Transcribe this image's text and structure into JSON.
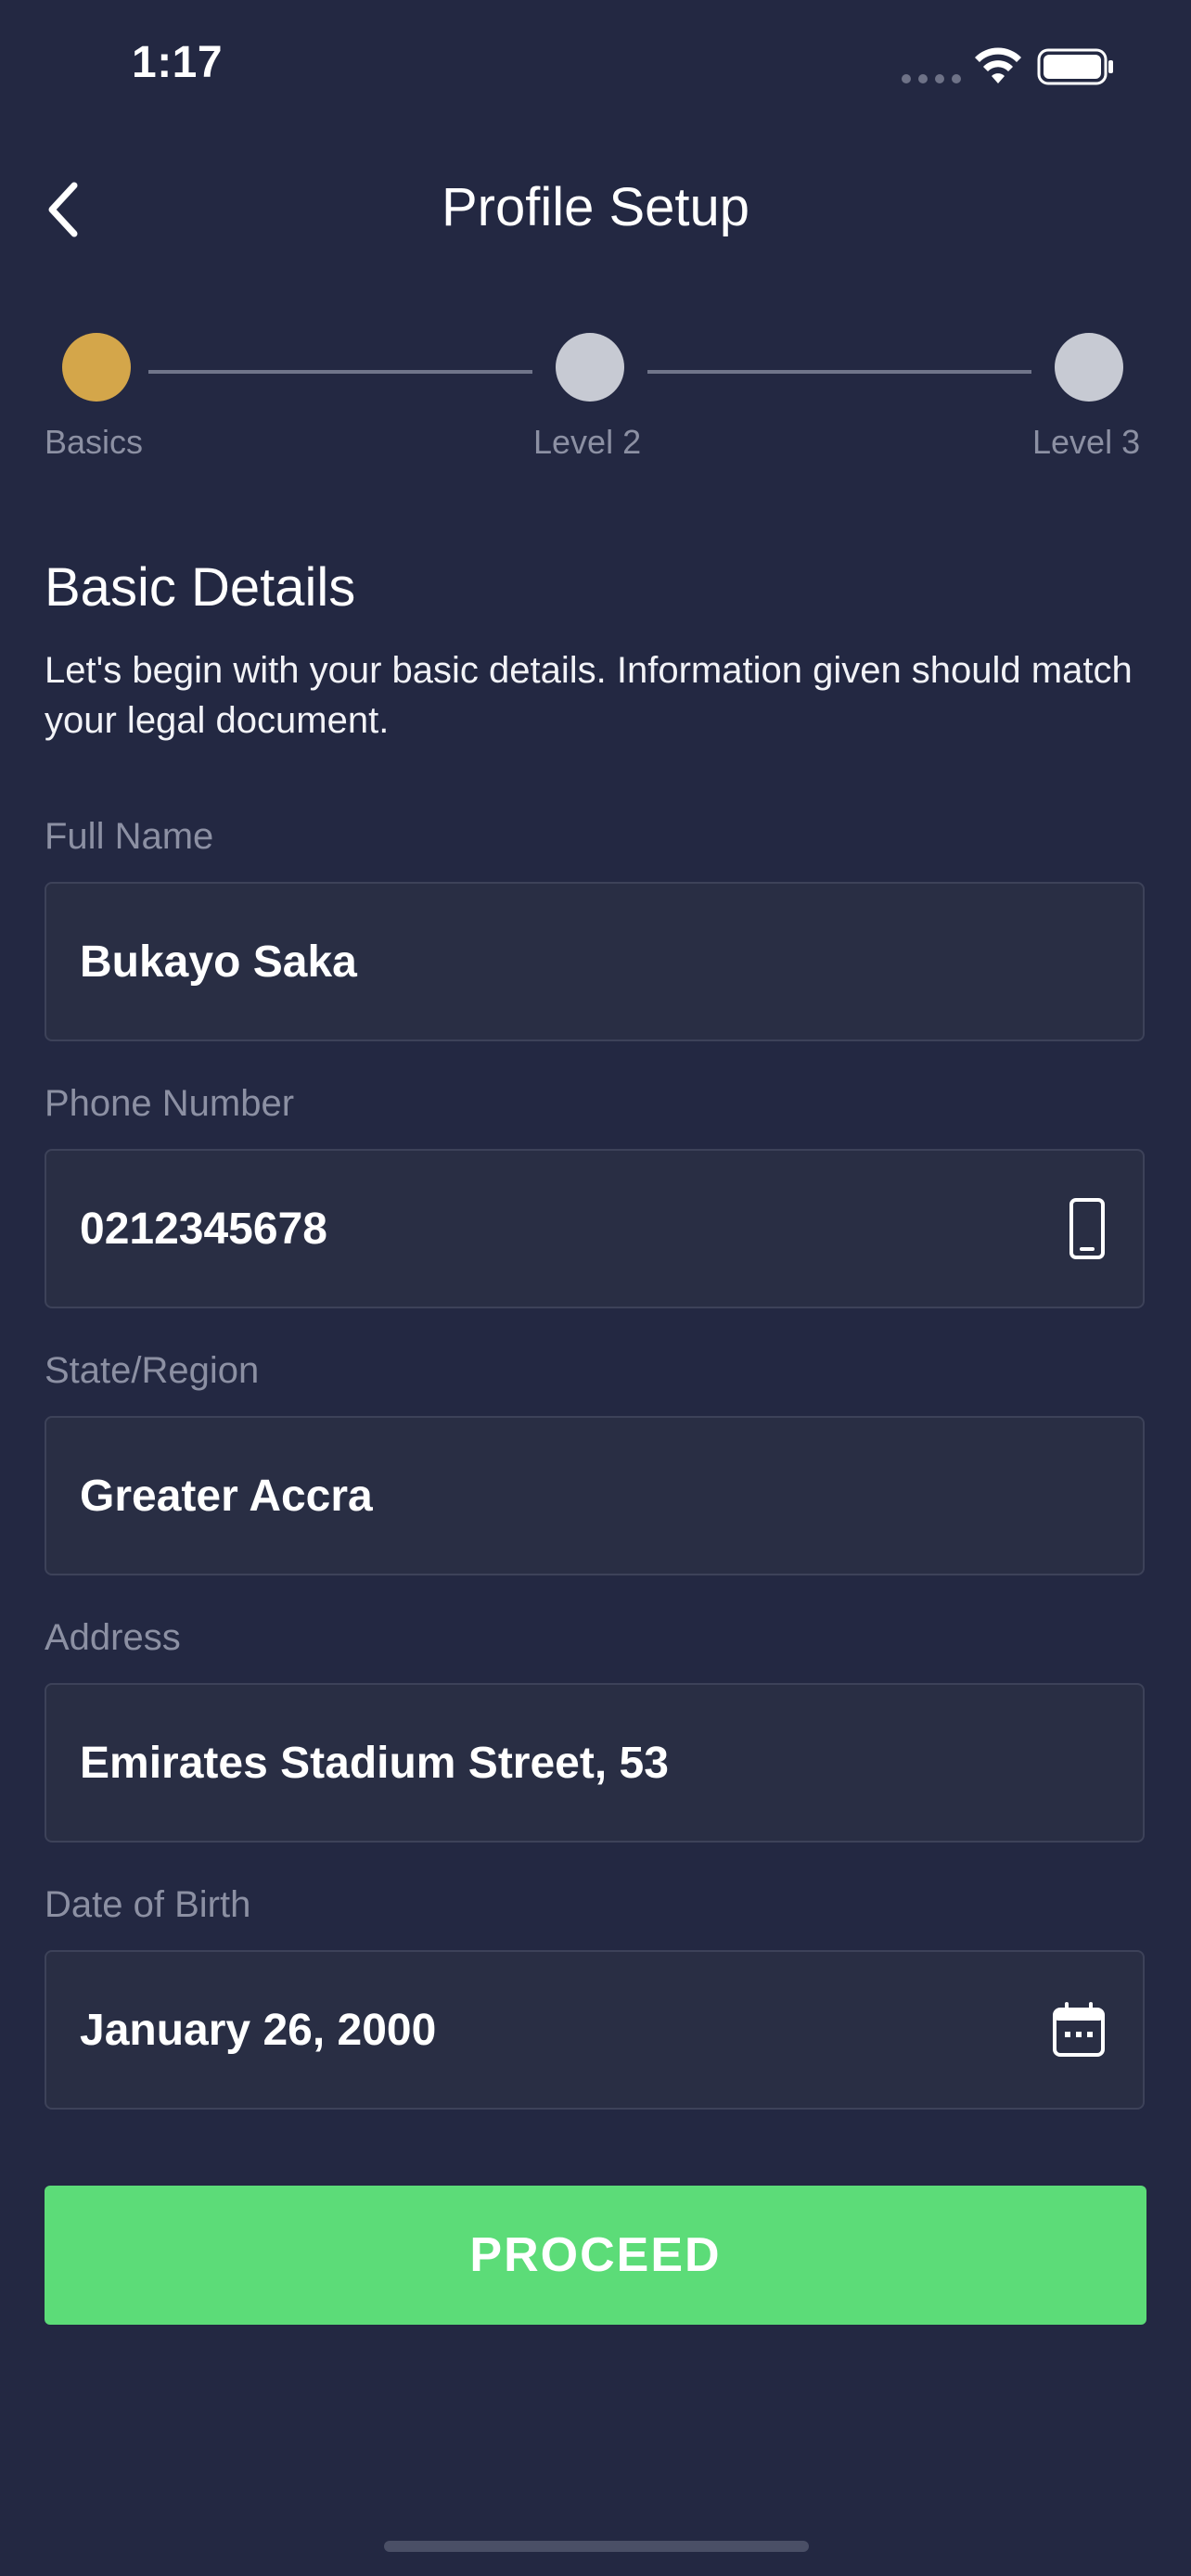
{
  "status_bar": {
    "time": "1:17"
  },
  "nav": {
    "back_icon": "chevron-left-icon",
    "title": "Profile Setup"
  },
  "stepper": {
    "steps": [
      {
        "label": "Basics",
        "state": "active",
        "color": "#d4a64a"
      },
      {
        "label": "Level 2",
        "state": "pending",
        "color": "#c7cad3"
      },
      {
        "label": "Level 3",
        "state": "pending",
        "color": "#c7cad3"
      }
    ]
  },
  "section": {
    "title": "Basic Details",
    "description": "Let's begin with your basic details. Information given should match your legal document."
  },
  "form": {
    "full_name": {
      "label": "Full Name",
      "value": "Bukayo Saka"
    },
    "phone": {
      "label": "Phone Number",
      "value": "0212345678",
      "icon": "mobile-phone-icon"
    },
    "region": {
      "label": "State/Region",
      "value": "Greater Accra"
    },
    "address": {
      "label": "Address",
      "value": "Emirates Stadium Street, 53"
    },
    "dob": {
      "label": "Date of Birth",
      "value": "January 26, 2000",
      "icon": "calendar-icon"
    }
  },
  "actions": {
    "proceed_label": "PROCEED"
  },
  "colors": {
    "background": "#232842",
    "field_bg": "#292e44",
    "accent_green": "#5cdc78",
    "step_active": "#d4a64a"
  }
}
